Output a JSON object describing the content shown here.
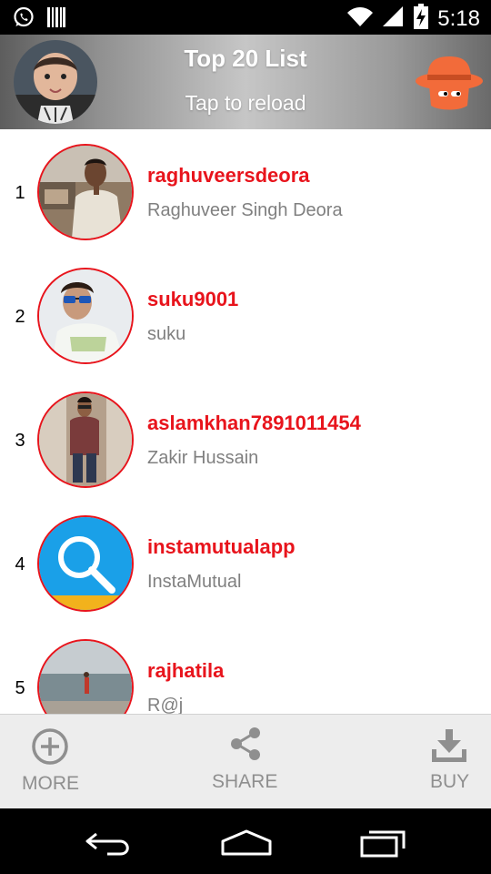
{
  "status_bar": {
    "time": "5:18",
    "left_icons": [
      "whatsapp-icon",
      "barcode-icon"
    ],
    "right_icons": [
      "wifi-icon",
      "signal-icon",
      "battery-charging-icon"
    ]
  },
  "header": {
    "title": "Top 20 List",
    "subtitle": "Tap to reload",
    "icons": [
      "profile-avatar",
      "incognito-spy-icon"
    ]
  },
  "list": {
    "items": [
      {
        "rank": "1",
        "username": "raghuveersdeora",
        "name": "Raghuveer Singh Deora"
      },
      {
        "rank": "2",
        "username": "suku9001",
        "name": "suku"
      },
      {
        "rank": "3",
        "username": "aslamkhan7891011454",
        "name": "Zakir Hussain"
      },
      {
        "rank": "4",
        "username": "instamutualapp",
        "name": "InstaMutual"
      },
      {
        "rank": "5",
        "username": "rajhatila",
        "name": "R@j"
      }
    ]
  },
  "bottom_bar": {
    "more_label": "MORE",
    "share_label": "SHARE",
    "buy_label": "BUY",
    "icons": [
      "plus-circle-icon",
      "share-icon",
      "download-icon"
    ]
  },
  "nav_bar": {
    "icons": [
      "back-icon",
      "home-icon",
      "recents-icon"
    ]
  },
  "colors": {
    "accent_red": "#e8141c",
    "secondary_gray": "#808080",
    "spy_orange": "#f26b3a"
  }
}
